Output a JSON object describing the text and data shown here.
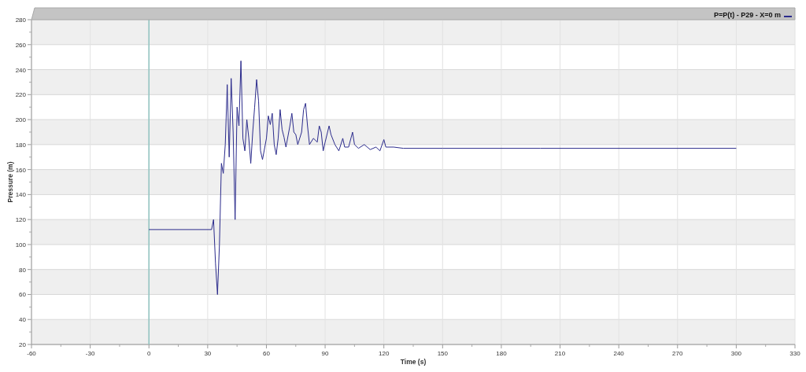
{
  "chart": {
    "chart_data": {
      "type": "line",
      "xlabel": "Time (s)",
      "ylabel": "Pressure (m)",
      "x": [
        0,
        32,
        33,
        34,
        35,
        36,
        37,
        38,
        39,
        40,
        41,
        42,
        43,
        44,
        45,
        46,
        47,
        48,
        49,
        50,
        51,
        52,
        53,
        54,
        55,
        56,
        57,
        58,
        60,
        61,
        62,
        63,
        64,
        65,
        66,
        67,
        68,
        69,
        70,
        72,
        73,
        74,
        75,
        76,
        78,
        79,
        80,
        81,
        82,
        84,
        86,
        87,
        88,
        89,
        90,
        92,
        93,
        95,
        97,
        99,
        100,
        102,
        104,
        105,
        107,
        110,
        113,
        116,
        118,
        120,
        121,
        125,
        130,
        150,
        200,
        250,
        300
      ],
      "series": [
        {
          "name": "P=P(t) - P29 - X=0 m",
          "color": "#2b2b8c",
          "values": [
            112,
            112,
            120,
            85,
            60,
            100,
            165,
            157,
            180,
            228,
            170,
            233,
            190,
            120,
            210,
            195,
            247,
            185,
            175,
            200,
            185,
            165,
            190,
            210,
            232,
            215,
            175,
            168,
            185,
            203,
            196,
            205,
            180,
            172,
            185,
            208,
            192,
            186,
            178,
            195,
            205,
            190,
            188,
            180,
            190,
            208,
            213,
            195,
            180,
            185,
            182,
            195,
            190,
            175,
            182,
            195,
            188,
            180,
            175,
            185,
            178,
            178,
            190,
            180,
            177,
            180,
            176,
            178,
            175,
            184,
            178,
            178,
            177,
            177,
            177,
            177,
            177
          ]
        }
      ],
      "grid": true,
      "ref_lines": [
        {
          "axis": "x",
          "value": 0,
          "color": "#8fc3c0"
        }
      ],
      "xlim": [
        -60,
        330
      ],
      "ylim": [
        20,
        280
      ],
      "xticks": [
        -60,
        -30,
        0,
        30,
        60,
        90,
        120,
        150,
        180,
        210,
        240,
        270,
        300,
        330
      ],
      "yticks": [
        20,
        40,
        60,
        80,
        100,
        120,
        140,
        160,
        180,
        200,
        220,
        240,
        260,
        280
      ]
    }
  }
}
